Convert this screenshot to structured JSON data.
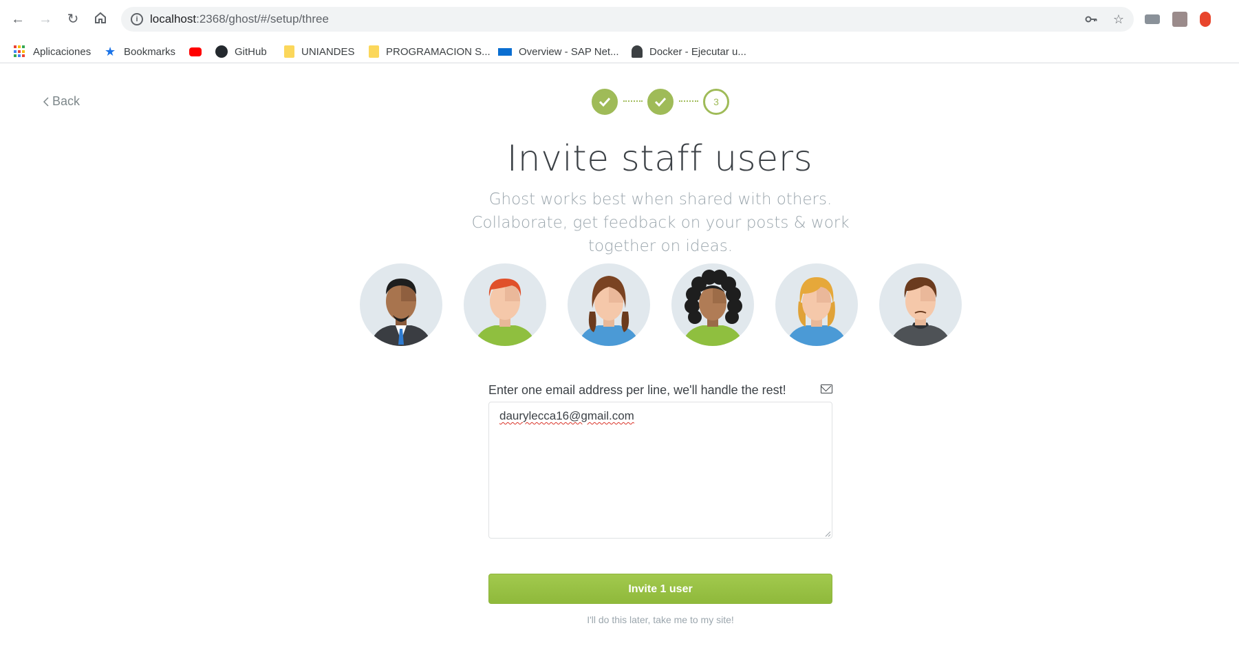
{
  "browser": {
    "url_host": "localhost",
    "url_rest": ":2368/ghost/#/setup/three",
    "icons": [
      "back-icon",
      "forward-icon",
      "reload-icon",
      "home-icon",
      "site-info-icon",
      "key-icon",
      "star-icon"
    ],
    "bookmarks": [
      {
        "label": "Aplicaciones",
        "icon": "apps-grid-icon"
      },
      {
        "label": "Bookmarks",
        "icon": "star-icon"
      },
      {
        "label": "",
        "icon": "youtube-icon"
      },
      {
        "label": "GitHub",
        "icon": "github-icon"
      },
      {
        "label": "UNIANDES",
        "icon": "folder-icon"
      },
      {
        "label": "PROGRAMACION S...",
        "icon": "folder-icon"
      },
      {
        "label": "Overview - SAP Net...",
        "icon": "sap-icon"
      },
      {
        "label": "Docker - Ejecutar u...",
        "icon": "docker-icon"
      }
    ]
  },
  "page": {
    "back_label": "Back",
    "steps": [
      {
        "state": "done"
      },
      {
        "state": "done"
      },
      {
        "state": "current",
        "label": "3"
      }
    ],
    "title": "Invite staff users",
    "subtitle": "Ghost works best when shared with others. Collaborate, get feedback on your posts & work together on ideas.",
    "avatars": [
      "avatar-bearded-man",
      "avatar-redhead-man",
      "avatar-pigtails-woman",
      "avatar-curly-woman",
      "avatar-blonde-woman",
      "avatar-brown-hair-man"
    ],
    "form_label": "Enter one email address per line, we'll handle the rest!",
    "emails_value": "daurylecca16@gmail.com",
    "invite_button": "Invite 1 user",
    "skip_link": "I'll do this later, take me to my site!"
  },
  "colors": {
    "accent_green": "#9fbb58",
    "button_green": "#9ac445",
    "text_dark": "#3c4146",
    "text_muted": "#9ba6ad"
  }
}
